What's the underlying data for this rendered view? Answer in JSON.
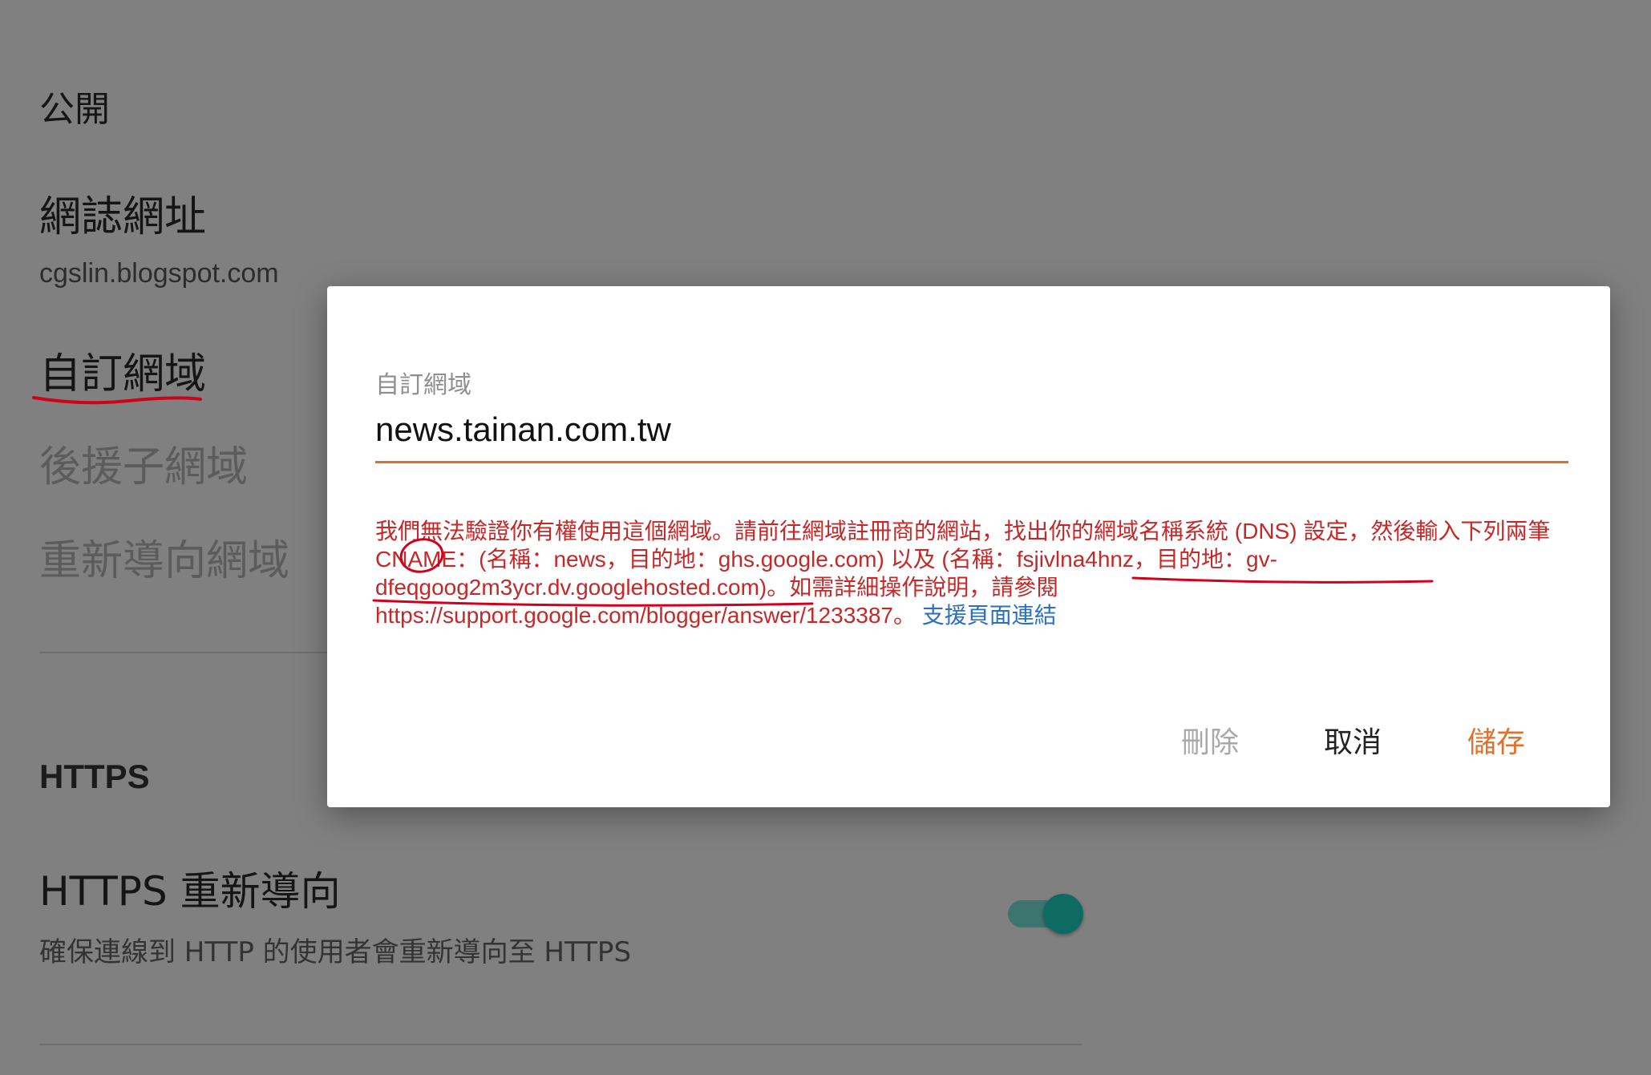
{
  "settings": {
    "visibility_heading": "公開",
    "blog_address_heading": "網誌網址",
    "blog_address_value": "cgslin.blogspot.com",
    "custom_domain_item": "自訂網域",
    "fallback_subdomain_item": "後援子網域",
    "redirect_domain_item": "重新導向網域",
    "https_section_title": "HTTPS",
    "https_redirect_heading": "HTTPS 重新導向",
    "https_redirect_desc": "確保連線到 HTTP 的使用者會重新導向至 HTTPS",
    "https_redirect_enabled": true
  },
  "dialog": {
    "field_label": "自訂網域",
    "field_value": "news.tainan.com.tw",
    "error_text": "我們無法驗證你有權使用這個網域。請前往網域註冊商的網站，找出你的網域名稱系統 (DNS) 設定，然後輸入下列兩筆 CNAME：(名稱：news，目的地：ghs.google.com) 以及 (名稱：fsjivlna4hnz，目的地：gv-dfeqgoog2m3ycr.dv.googlehosted.com)。如需詳細操作說明，請參閱 https://support.google.com/blogger/answer/1233387。",
    "support_link": "支援頁面連結",
    "delete_label": "刪除",
    "cancel_label": "取消",
    "save_label": "儲存"
  },
  "colors": {
    "accent": "#e46f2a",
    "error": "#c62828",
    "link": "#2a6fc4",
    "toggle": "#0e6b64",
    "annotation": "#d0021b"
  }
}
